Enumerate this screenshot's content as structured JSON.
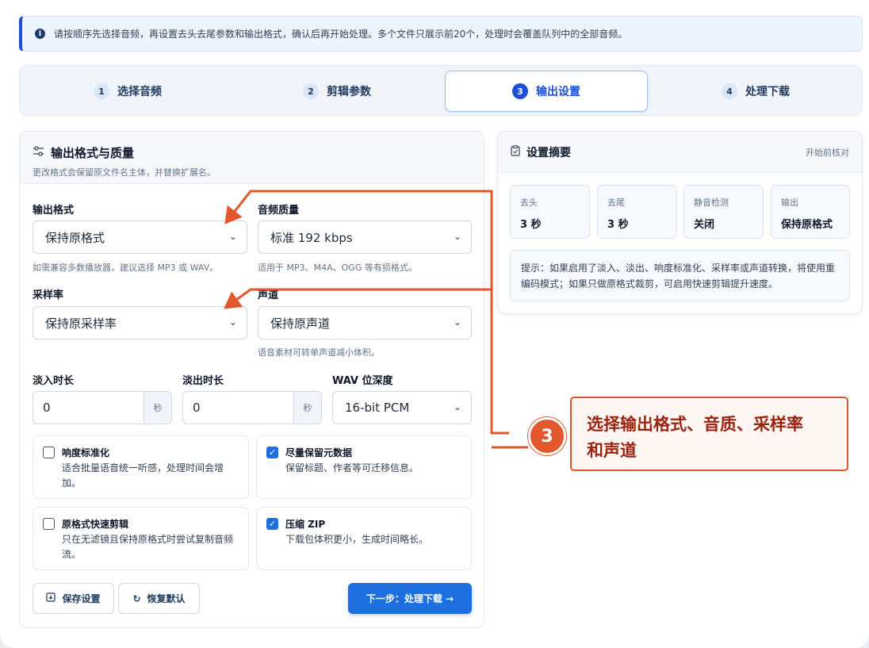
{
  "banner": {
    "icon": "info-icon",
    "text": "请按顺序先选择音频，再设置去头去尾参数和输出格式，确认后再开始处理。多个文件只展示前20个，处理时会覆盖队列中的全部音频。"
  },
  "steps": [
    {
      "num": "1",
      "label": "选择音频"
    },
    {
      "num": "2",
      "label": "剪辑参数"
    },
    {
      "num": "3",
      "label": "输出设置"
    },
    {
      "num": "4",
      "label": "处理下载"
    }
  ],
  "format_card": {
    "icon": "sliders-icon",
    "title": "输出格式与质量",
    "subtitle": "更改格式会保留原文件名主体，并替换扩展名。",
    "output_format": {
      "label": "输出格式",
      "value": "保持原格式",
      "hint": "如需兼容多数播放器，建议选择 MP3 或 WAV。"
    },
    "quality": {
      "label": "音频质量",
      "value": "标准 192 kbps",
      "hint": "适用于 MP3、M4A、OGG 等有损格式。"
    },
    "sample_rate": {
      "label": "采样率",
      "value": "保持原采样率"
    },
    "channels": {
      "label": "声道",
      "value": "保持原声道",
      "hint": "语音素材可转单声道减小体积。"
    },
    "fade_in": {
      "label": "淡入时长",
      "value": "0",
      "unit": "秒"
    },
    "fade_out": {
      "label": "淡出时长",
      "value": "0",
      "unit": "秒"
    },
    "wav_depth": {
      "label": "WAV 位深度",
      "value": "16-bit PCM"
    },
    "options": [
      {
        "title": "响度标准化",
        "desc": "适合批量语音统一听感，处理时间会增加。",
        "checked": false
      },
      {
        "title": "尽量保留元数据",
        "desc": "保留标题、作者等可迁移信息。",
        "checked": true
      },
      {
        "title": "原格式快速剪辑",
        "desc": "只在无滤镜且保持原格式时尝试复制音频流。",
        "checked": false
      },
      {
        "title": "压缩 ZIP",
        "desc": "下载包体积更小，生成时间略长。",
        "checked": true
      }
    ],
    "save_btn": "保存设置",
    "reset_btn": "恢复默认",
    "next_btn": "下一步：处理下载 →"
  },
  "summary": {
    "icon": "clipboard-icon",
    "title": "设置摘要",
    "right_note": "开始前核对",
    "stats": [
      {
        "key": "去头",
        "value": "3 秒"
      },
      {
        "key": "去尾",
        "value": "3 秒"
      },
      {
        "key": "静音检测",
        "value": "关闭"
      },
      {
        "key": "输出",
        "value": "保持原格式"
      }
    ],
    "tip": "提示：如果启用了淡入、淡出、响度标准化、采样率或声道转换，将使用重编码模式；如果只做原格式裁剪，可启用快速剪辑提升速度。"
  },
  "annotation": {
    "number": "3",
    "line1": "选择输出格式、音质、采样率",
    "line2": "和声道",
    "color": "#e2572b"
  }
}
